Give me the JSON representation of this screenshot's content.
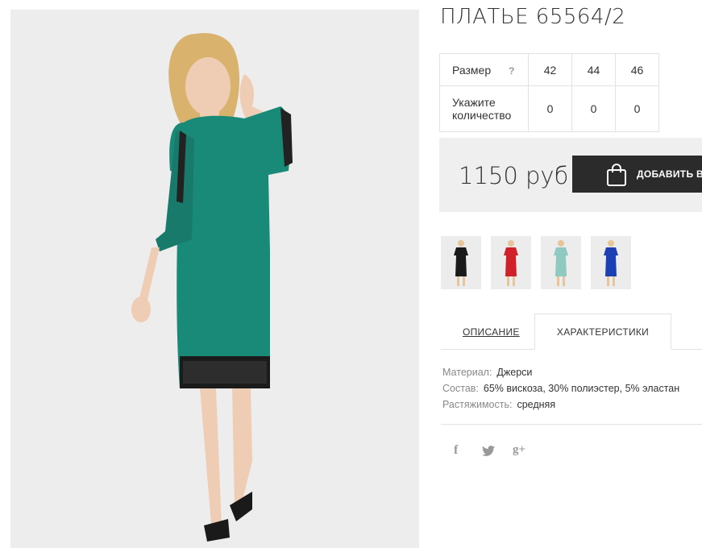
{
  "product": {
    "title": "ПЛАТЬЕ 65564/2",
    "image_alt_icon": "dress-photo"
  },
  "size_table": {
    "size_label": "Размер",
    "help_label": "?",
    "quantity_label": "Укажите количество",
    "sizes": [
      "42",
      "44",
      "46"
    ],
    "quantities": [
      "0",
      "0",
      "0"
    ]
  },
  "price": {
    "value": "1150 руб",
    "cart_button_label": "ДОБАВИТЬ В",
    "cart_icon": "shopping-bag-icon"
  },
  "thumbnails": [
    {
      "color": "#1a1a1a",
      "name": "black"
    },
    {
      "color": "#d0202a",
      "name": "red"
    },
    {
      "color": "#8fc9bf",
      "name": "mint"
    },
    {
      "color": "#1c3fb3",
      "name": "blue"
    }
  ],
  "tabs": {
    "description": "ОПИСАНИЕ",
    "characteristics": "ХАРАКТЕРИСТИКИ"
  },
  "characteristics": [
    {
      "key": "Материал:",
      "value": "Джерси"
    },
    {
      "key": "Состав:",
      "value": "65% вискоза, 30% полиэстер, 5% эластан"
    },
    {
      "key": "Растяжимость:",
      "value": "средняя"
    }
  ],
  "social": {
    "facebook": "f",
    "twitter": "twitter-icon",
    "googleplus": "g+"
  },
  "colors": {
    "dress": "#1a8a78",
    "button": "#2b2b2b",
    "price_bg": "#efefef"
  }
}
